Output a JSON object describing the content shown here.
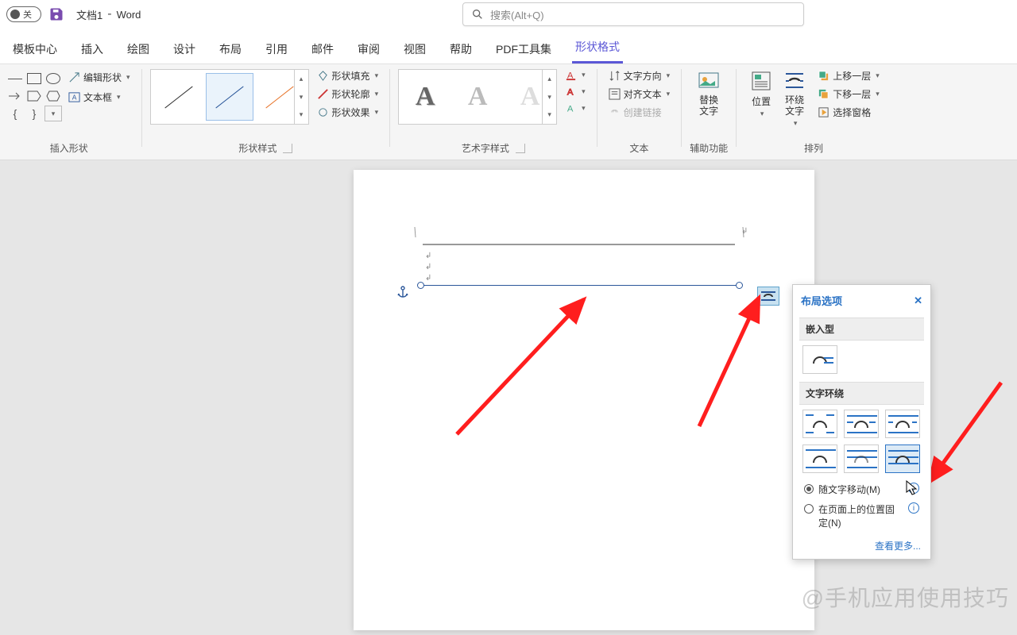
{
  "titlebar": {
    "toggle": "关",
    "doc": "文档1",
    "app": "Word",
    "search_placeholder": "搜索(Alt+Q)"
  },
  "tabs": [
    "模板中心",
    "插入",
    "绘图",
    "设计",
    "布局",
    "引用",
    "邮件",
    "审阅",
    "视图",
    "帮助",
    "PDF工具集",
    "形状格式"
  ],
  "ribbon": {
    "insert_shapes": {
      "edit_shape": "编辑形状",
      "textbox": "文本框",
      "label": "插入形状"
    },
    "shape_styles": {
      "fill": "形状填充",
      "outline": "形状轮廓",
      "effects": "形状效果",
      "label": "形状样式"
    },
    "wordart": {
      "label": "艺术字样式"
    },
    "text": {
      "direction": "文字方向",
      "align": "对齐文本",
      "link": "创建链接",
      "label": "文本"
    },
    "accessibility": {
      "alt_text": "替换文字",
      "label": "辅助功能"
    },
    "arrange": {
      "position": "位置",
      "wrap": "环绕文字",
      "bring_fwd": "上移一层",
      "send_back": "下移一层",
      "selection": "选择窗格",
      "label": "排列"
    }
  },
  "panel": {
    "title": "布局选项",
    "inline": "嵌入型",
    "wrap": "文字环绕",
    "move_with_text": "随文字移动(M)",
    "fix_on_page": "在页面上的位置固定(N)",
    "see_more": "查看更多..."
  },
  "watermark": "@手机应用使用技巧"
}
